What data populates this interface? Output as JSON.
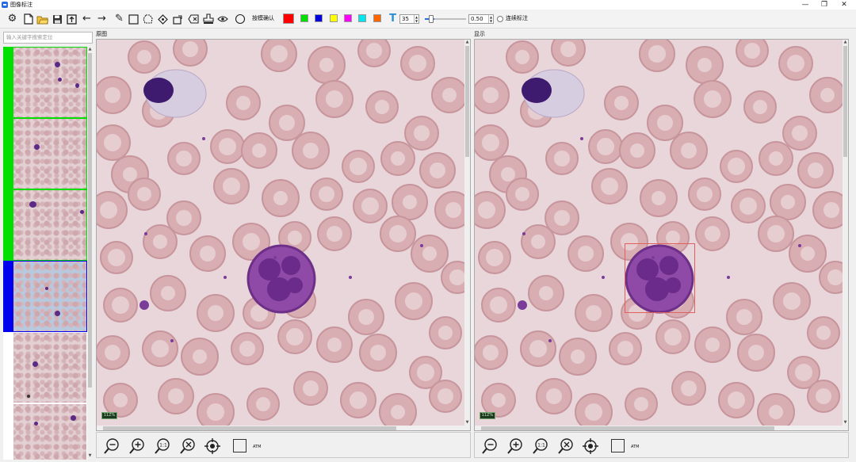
{
  "window": {
    "title": "图像标注",
    "minimize": "—",
    "restore": "❐",
    "close": "✕"
  },
  "toolbar": {
    "icons": [
      "gear-icon",
      "new-file-icon",
      "open-folder-icon",
      "save-icon",
      "export-icon",
      "undo-arrow-icon",
      "redo-arrow-icon",
      "pencil-icon",
      "rectangle-icon",
      "polygon-icon",
      "diamond-icon",
      "rotate-icon",
      "eraser-icon",
      "stamp-icon",
      "eye-icon"
    ],
    "template_confirm_label": "按模确认",
    "colors": [
      "#ff0000",
      "#00dd00",
      "#0000dd",
      "#ffff00",
      "#ff00ff",
      "#00e5ee",
      "#ff6600"
    ],
    "font_size_value": "35",
    "opacity_value": "0.50",
    "opacity_level": 0.12,
    "continuous_label": "连续标注",
    "accent": "#2b6de0"
  },
  "sidebar": {
    "search_placeholder": "输入关键字搜索定位",
    "thumbnails": [
      {
        "status_color": "#00e000",
        "selected": false
      },
      {
        "status_color": "#00e000",
        "selected": false
      },
      {
        "status_color": "#00e000",
        "selected": false
      },
      {
        "status_color": "#0000ee",
        "selected": true
      },
      {
        "status_color": "",
        "selected": false
      },
      {
        "status_color": "",
        "selected": false
      }
    ]
  },
  "panels": {
    "original_label": "原图",
    "display_label": "显示",
    "scale_label": "11Z%",
    "fit_label": "ATM"
  },
  "annotation": {
    "box_color": "#e06060"
  }
}
